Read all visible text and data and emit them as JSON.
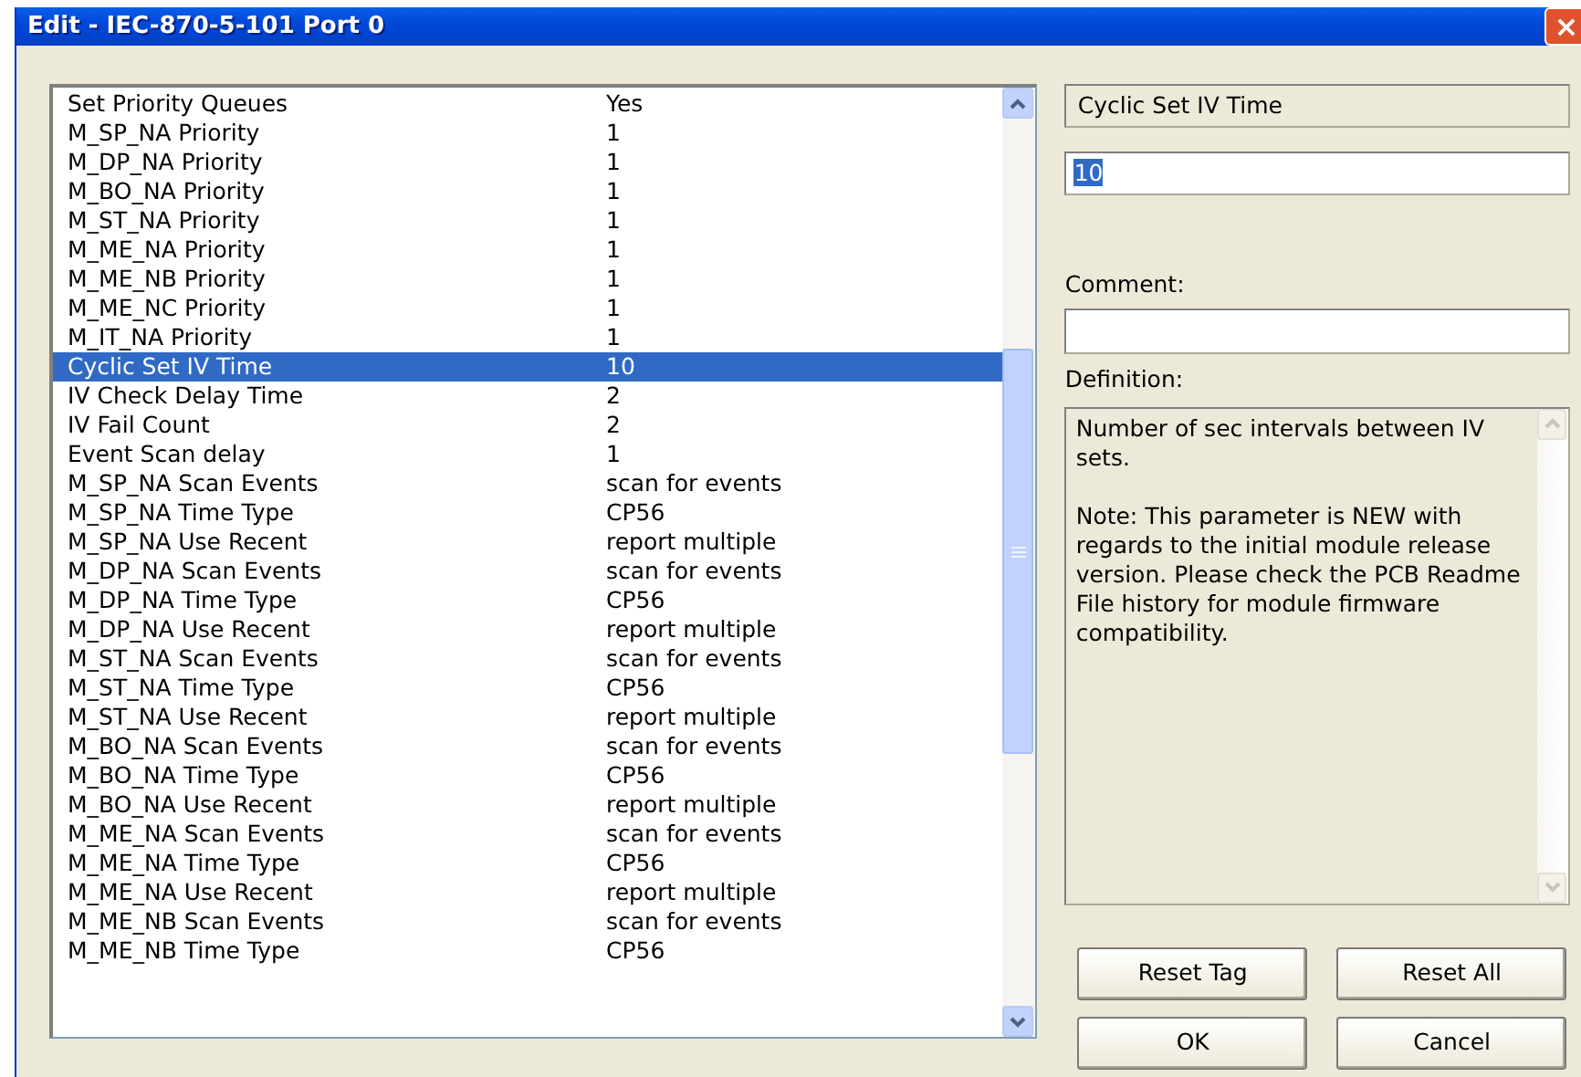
{
  "window": {
    "title": "Edit - IEC-870-5-101 Port 0",
    "close_symbol": "×"
  },
  "rows": [
    {
      "name": "Set Priority Queues",
      "value": "Yes",
      "selected": false
    },
    {
      "name": "M_SP_NA Priority",
      "value": "1",
      "selected": false
    },
    {
      "name": "M_DP_NA Priority",
      "value": "1",
      "selected": false
    },
    {
      "name": "M_BO_NA Priority",
      "value": "1",
      "selected": false
    },
    {
      "name": "M_ST_NA Priority",
      "value": "1",
      "selected": false
    },
    {
      "name": "M_ME_NA Priority",
      "value": "1",
      "selected": false
    },
    {
      "name": "M_ME_NB Priority",
      "value": "1",
      "selected": false
    },
    {
      "name": "M_ME_NC Priority",
      "value": "1",
      "selected": false
    },
    {
      "name": "M_IT_NA Priority",
      "value": "1",
      "selected": false
    },
    {
      "name": "Cyclic Set IV Time",
      "value": "10",
      "selected": true
    },
    {
      "name": "IV Check Delay Time",
      "value": "2",
      "selected": false
    },
    {
      "name": "IV Fail Count",
      "value": "2",
      "selected": false
    },
    {
      "name": "Event Scan delay",
      "value": "1",
      "selected": false
    },
    {
      "name": "M_SP_NA Scan Events",
      "value": "scan for events",
      "selected": false
    },
    {
      "name": "M_SP_NA Time Type",
      "value": "CP56",
      "selected": false
    },
    {
      "name": "M_SP_NA Use Recent",
      "value": "report multiple",
      "selected": false
    },
    {
      "name": "M_DP_NA Scan Events",
      "value": "scan for events",
      "selected": false
    },
    {
      "name": "M_DP_NA Time Type",
      "value": "CP56",
      "selected": false
    },
    {
      "name": "M_DP_NA Use Recent",
      "value": "report multiple",
      "selected": false
    },
    {
      "name": "M_ST_NA Scan Events",
      "value": "scan for events",
      "selected": false
    },
    {
      "name": "M_ST_NA Time Type",
      "value": "CP56",
      "selected": false
    },
    {
      "name": "M_ST_NA Use Recent",
      "value": "report multiple",
      "selected": false
    },
    {
      "name": "M_BO_NA Scan Events",
      "value": "scan for events",
      "selected": false
    },
    {
      "name": "M_BO_NA Time Type",
      "value": "CP56",
      "selected": false
    },
    {
      "name": "M_BO_NA Use Recent",
      "value": "report multiple",
      "selected": false
    },
    {
      "name": "M_ME_NA Scan Events",
      "value": "scan for events",
      "selected": false
    },
    {
      "name": "M_ME_NA Time Type",
      "value": "CP56",
      "selected": false
    },
    {
      "name": "M_ME_NA Use Recent",
      "value": "report multiple",
      "selected": false
    },
    {
      "name": "M_ME_NB Scan Events",
      "value": "scan for events",
      "selected": false
    },
    {
      "name": "M_ME_NB Time Type",
      "value": "CP56",
      "selected": false
    }
  ],
  "detail": {
    "tag_name": "Cyclic Set IV Time",
    "value": "10",
    "value_highlighted": true,
    "comment_label": "Comment:",
    "definition_label": "Definition:",
    "definition": [
      "Number of sec intervals between IV sets.",
      "Note: This parameter is NEW with regards to the initial module release version. Please check the PCB Readme File history for module firmware compatibility."
    ]
  },
  "buttons": [
    "Reset Tag",
    "Reset All",
    "OK",
    "Cancel"
  ]
}
